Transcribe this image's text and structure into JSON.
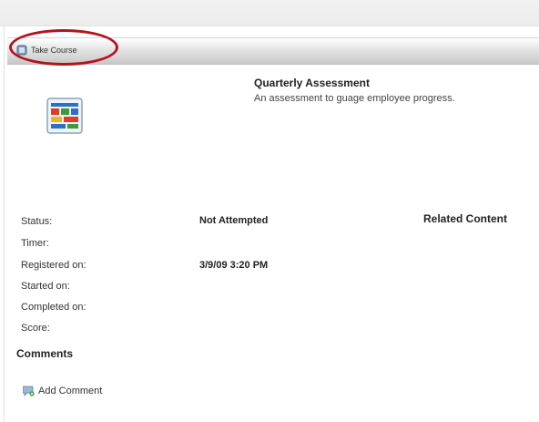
{
  "toolbar": {
    "take_course_label": "Take Course"
  },
  "course": {
    "title": "Quarterly Assessment",
    "description": "An assessment to guage employee progress."
  },
  "details": {
    "status_label": "Status:",
    "status_value": "Not Attempted",
    "timer_label": "Timer:",
    "registered_label": "Registered on:",
    "registered_value": "3/9/09 3:20 PM",
    "started_label": "Started on:",
    "completed_label": "Completed on:",
    "score_label": "Score:"
  },
  "related": {
    "heading": "Related Content"
  },
  "comments": {
    "heading": "Comments",
    "add_label": "Add Comment"
  },
  "colors": {
    "highlight": "#b5121b",
    "toolbar": "#d0d0d0"
  },
  "icons": {
    "take_course": "course-play-icon",
    "course": "course-thumbnail-icon",
    "add_comment": "add-comment-icon"
  }
}
